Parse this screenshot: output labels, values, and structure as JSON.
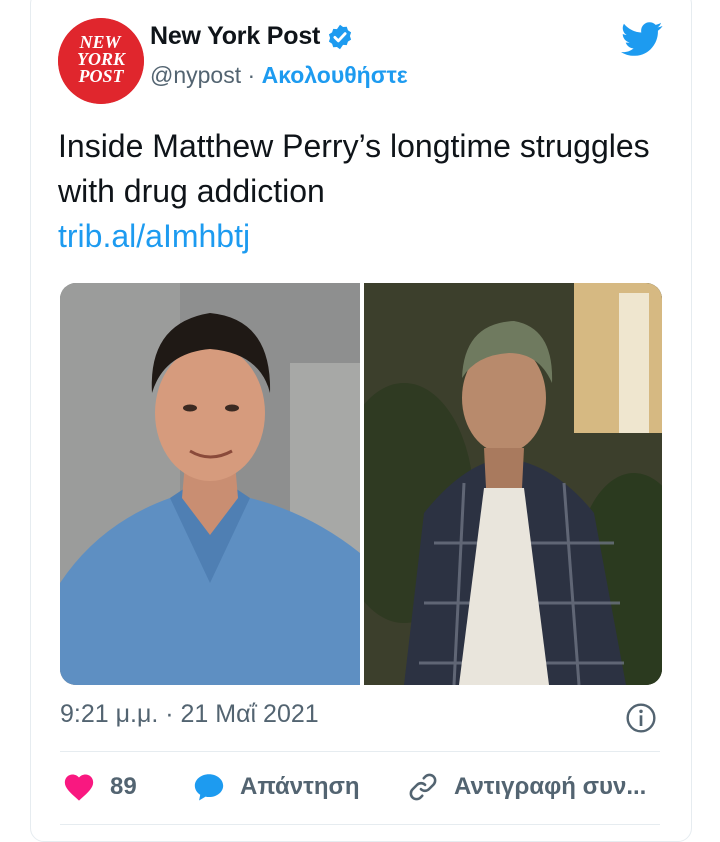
{
  "tweet": {
    "author_name": "New York Post",
    "handle": "@nypost",
    "separator": " · ",
    "follow_label": "Ακολουθήστε",
    "avatar_logo_lines": [
      "NEW",
      "YORK",
      "POST"
    ],
    "text": "Inside Matthew Perry’s longtime struggles with drug addiction",
    "link": "trib.al/aImhbtj",
    "timestamp": "9:21 μ.μ. · 21 Μαΐ 2021"
  },
  "actions": {
    "like_count": "89",
    "reply_label": "Απάντηση",
    "copy_label": "Αντιγραφή συν..."
  },
  "colors": {
    "accent": "#1d9bf0",
    "like": "#f91880",
    "brand_red": "#e0262d",
    "secondary_text": "#536471"
  },
  "icons": [
    "verified-badge-icon",
    "twitter-bird-icon",
    "info-icon",
    "heart-icon",
    "reply-bubble-icon",
    "link-icon"
  ]
}
